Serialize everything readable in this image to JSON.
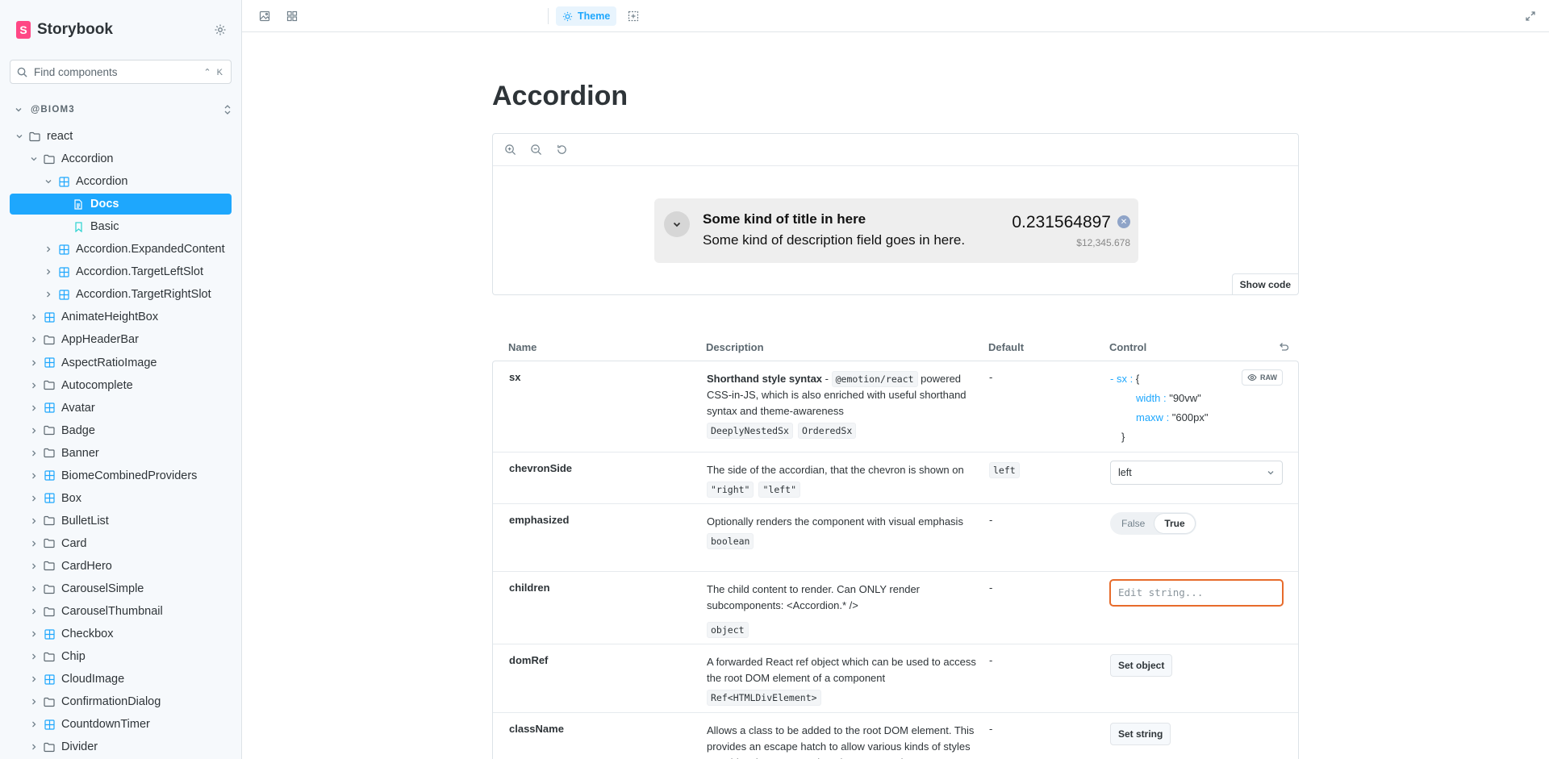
{
  "brand": {
    "name": "Storybook",
    "logo_letter": "S"
  },
  "search": {
    "placeholder": "Find components",
    "shortcut": "⌃ K"
  },
  "section": {
    "label": "@BIOM3"
  },
  "tree": [
    {
      "label": "react",
      "kind": "folder",
      "depth": 0,
      "expanded": true
    },
    {
      "label": "Accordion",
      "kind": "folder",
      "depth": 1,
      "expanded": true
    },
    {
      "label": "Accordion",
      "kind": "component",
      "depth": 2,
      "expanded": true
    },
    {
      "label": "Docs",
      "kind": "doc",
      "depth": 3,
      "active": true
    },
    {
      "label": "Basic",
      "kind": "story",
      "depth": 3
    },
    {
      "label": "Accordion.ExpandedContent",
      "kind": "component",
      "depth": 2
    },
    {
      "label": "Accordion.TargetLeftSlot",
      "kind": "component",
      "depth": 2
    },
    {
      "label": "Accordion.TargetRightSlot",
      "kind": "component",
      "depth": 2
    },
    {
      "label": "AnimateHeightBox",
      "kind": "component",
      "depth": 1
    },
    {
      "label": "AppHeaderBar",
      "kind": "folder",
      "depth": 1
    },
    {
      "label": "AspectRatioImage",
      "kind": "component",
      "depth": 1
    },
    {
      "label": "Autocomplete",
      "kind": "folder",
      "depth": 1
    },
    {
      "label": "Avatar",
      "kind": "component",
      "depth": 1
    },
    {
      "label": "Badge",
      "kind": "folder",
      "depth": 1
    },
    {
      "label": "Banner",
      "kind": "folder",
      "depth": 1
    },
    {
      "label": "BiomeCombinedProviders",
      "kind": "component",
      "depth": 1
    },
    {
      "label": "Box",
      "kind": "component",
      "depth": 1
    },
    {
      "label": "BulletList",
      "kind": "folder",
      "depth": 1
    },
    {
      "label": "Card",
      "kind": "folder",
      "depth": 1
    },
    {
      "label": "CardHero",
      "kind": "folder",
      "depth": 1
    },
    {
      "label": "CarouselSimple",
      "kind": "folder",
      "depth": 1
    },
    {
      "label": "CarouselThumbnail",
      "kind": "folder",
      "depth": 1
    },
    {
      "label": "Checkbox",
      "kind": "component",
      "depth": 1
    },
    {
      "label": "Chip",
      "kind": "folder",
      "depth": 1
    },
    {
      "label": "CloudImage",
      "kind": "component",
      "depth": 1
    },
    {
      "label": "ConfirmationDialog",
      "kind": "folder",
      "depth": 1
    },
    {
      "label": "CountdownTimer",
      "kind": "component",
      "depth": 1
    },
    {
      "label": "Divider",
      "kind": "folder",
      "depth": 1
    }
  ],
  "toolbar": {
    "theme_label": "Theme"
  },
  "page": {
    "title": "Accordion"
  },
  "preview": {
    "title": "Some kind of title in here",
    "description": "Some kind of description field goes in here.",
    "value": "0.231564897",
    "subvalue": "$12,345.678",
    "show_code": "Show code"
  },
  "table": {
    "headers": {
      "name": "Name",
      "description": "Description",
      "default": "Default",
      "control": "Control"
    },
    "rows": {
      "sx": {
        "name": "sx",
        "desc_bold": "Shorthand style syntax",
        "desc_dash": " - ",
        "desc_code": "@emotion/react",
        "desc_rest": " powered CSS-in-JS, which is also enriched with useful shorthand syntax and theme-awareness",
        "types": [
          "DeeplyNestedSx",
          "OrderedSx"
        ],
        "default": "-",
        "control": {
          "toggle": "-",
          "key": "sx",
          "colon": " : ",
          "open": "{",
          "close": "}",
          "entries": [
            {
              "k": "width",
              "v": "\"90vw\""
            },
            {
              "k": "maxw",
              "v": "\"600px\""
            }
          ],
          "raw_label": "RAW"
        }
      },
      "chevronSide": {
        "name": "chevronSide",
        "desc": "The side of the accordian, that the chevron is shown on",
        "types": [
          "\"right\"",
          "\"left\""
        ],
        "default": "left",
        "control": {
          "value": "left"
        }
      },
      "emphasized": {
        "name": "emphasized",
        "desc": "Optionally renders the component with visual emphasis",
        "types": [
          "boolean"
        ],
        "default": "-",
        "control": {
          "false_label": "False",
          "true_label": "True",
          "value": true
        }
      },
      "children": {
        "name": "children",
        "desc": "The child content to render. Can ONLY render subcomponents: <Accordion.* />",
        "types": [
          "object"
        ],
        "default": "-",
        "control": {
          "placeholder": "Edit string..."
        }
      },
      "domRef": {
        "name": "domRef",
        "desc": "A forwarded React ref object which can be used to access the root DOM element of a component",
        "types": [
          "Ref<HTMLDivElement>"
        ],
        "default": "-",
        "control": {
          "button": "Set object"
        }
      },
      "className": {
        "name": "className",
        "desc": "Allows a class to be added to the root DOM element. This provides an escape hatch to allow various kinds of styles overrides that are not otherwise supported.",
        "default": "-",
        "control": {
          "button": "Set string"
        }
      }
    }
  }
}
